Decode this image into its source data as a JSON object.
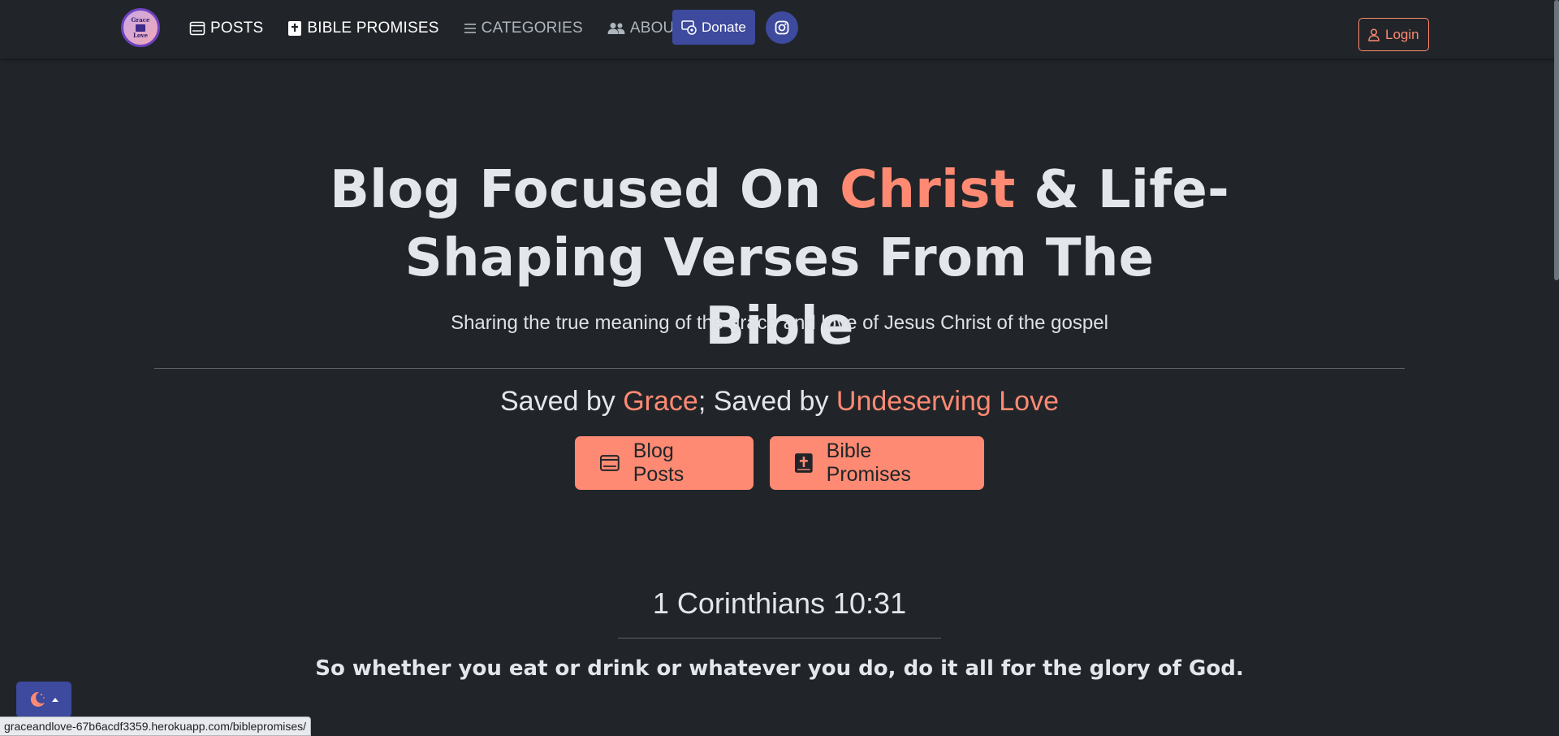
{
  "brand": {
    "logo_line1": "Grace",
    "logo_line2": "Love"
  },
  "nav": {
    "items": [
      {
        "label": "POSTS",
        "icon": "window-icon"
      },
      {
        "label": "BIBLE PROMISES",
        "icon": "bible-icon"
      },
      {
        "label": "CATEGORIES",
        "icon": "list-icon"
      },
      {
        "label": "ABOUT",
        "icon": "people-icon"
      }
    ],
    "donate_label": "Donate",
    "login_label": "Login"
  },
  "hero": {
    "title_part1": "Blog Focused On ",
    "title_accent": "Christ",
    "title_part2": " & Life-Shaping Verses From The Bible",
    "subtitle": "Sharing the true meaning of the grace and love of Jesus Christ of the gospel",
    "tagline_part1": "Saved by ",
    "tagline_accent1": "Grace",
    "tagline_part2": "; Saved by ",
    "tagline_accent2": "Undeserving Love",
    "cta_posts_label": "Blog Posts",
    "cta_promises_label": "Bible Promises"
  },
  "verse": {
    "reference": "1 Corinthians 10:31",
    "text": "So whether you eat or drink or whatever you do, do it all for the glory of God."
  },
  "status_bar": {
    "url": "graceandlove-67b6acdf3359.herokuapp.com/biblepromises/"
  },
  "colors": {
    "background": "#212529",
    "accent": "#ff8a73",
    "primary_button": "#3d4a9e",
    "text": "#dee2e6"
  }
}
